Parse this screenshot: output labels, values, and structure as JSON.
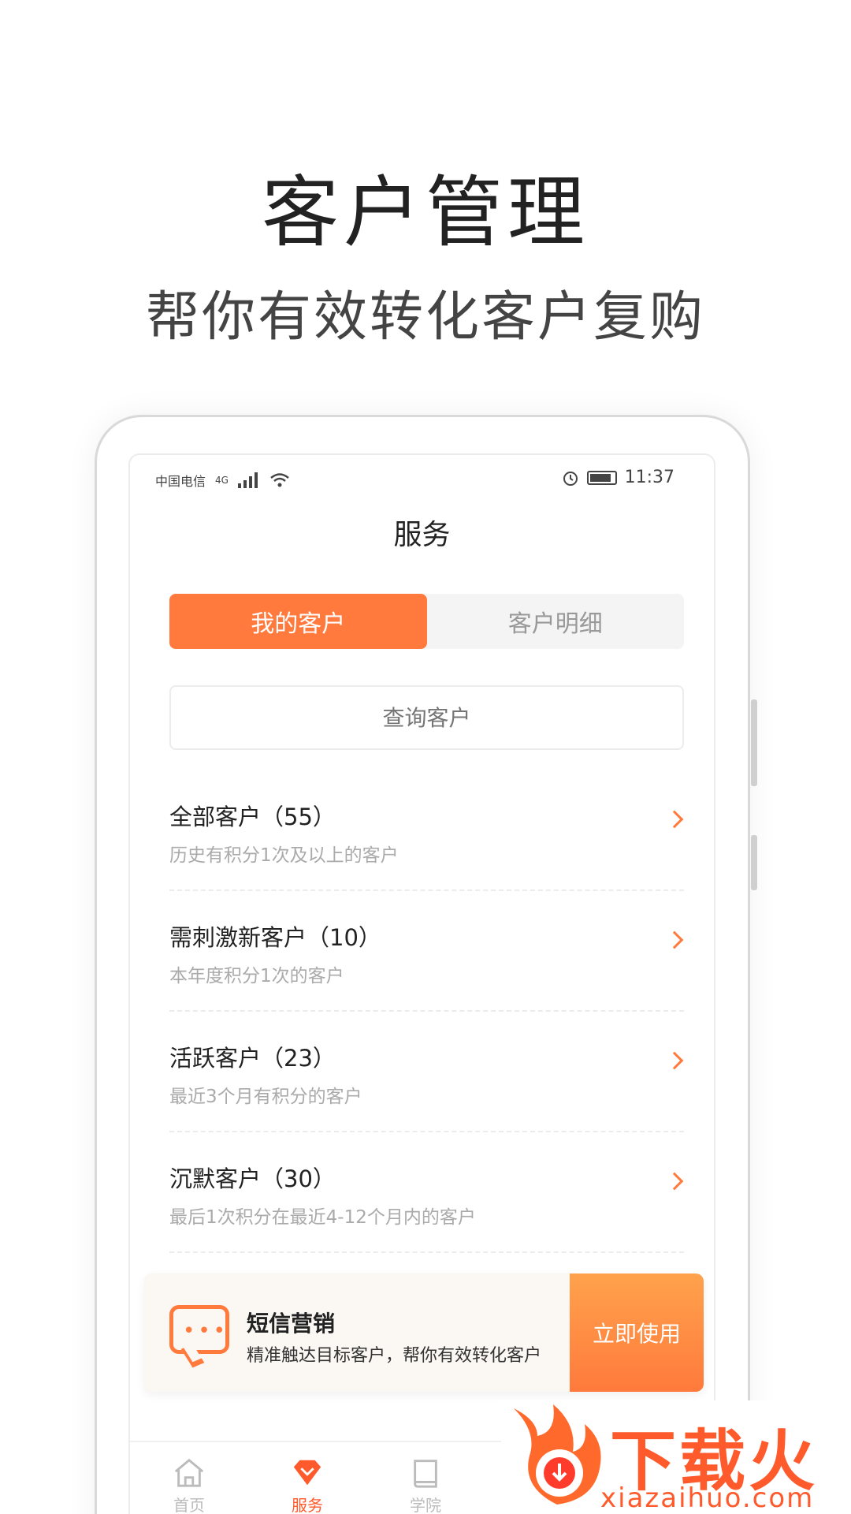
{
  "hero": {
    "title": "客户管理",
    "subtitle": "帮你有效转化客户复购"
  },
  "status_bar": {
    "carrier": "中国电信",
    "network": "4G",
    "time": "11:37"
  },
  "page_title": "服务",
  "tabs": [
    {
      "label": "我的客户",
      "active": true
    },
    {
      "label": "客户明细",
      "active": false
    }
  ],
  "search": {
    "placeholder": "查询客户"
  },
  "customer_groups": [
    {
      "title": "全部客户（55）",
      "desc": "历史有积分1次及以上的客户"
    },
    {
      "title": "需刺激新客户（10）",
      "desc": "本年度积分1次的客户"
    },
    {
      "title": "活跃客户（23）",
      "desc": "最近3个月有积分的客户"
    },
    {
      "title": "沉默客户（30）",
      "desc": "最后1次积分在最近4-12个月内的客户"
    }
  ],
  "sms_card": {
    "title": "短信营销",
    "desc": "精准触达目标客户，帮你有效转化客户",
    "button": "立即使用"
  },
  "bottom_nav": [
    {
      "label": "首页",
      "icon": "home-icon",
      "active": false
    },
    {
      "label": "服务",
      "icon": "diamond-icon",
      "active": true
    },
    {
      "label": "学院",
      "icon": "book-icon",
      "active": false
    }
  ],
  "watermark": {
    "text": "下载火",
    "url": "xiazaihuo.com"
  },
  "colors": {
    "accent": "#ff7a3c",
    "accent_dark": "#ff5a2c"
  }
}
